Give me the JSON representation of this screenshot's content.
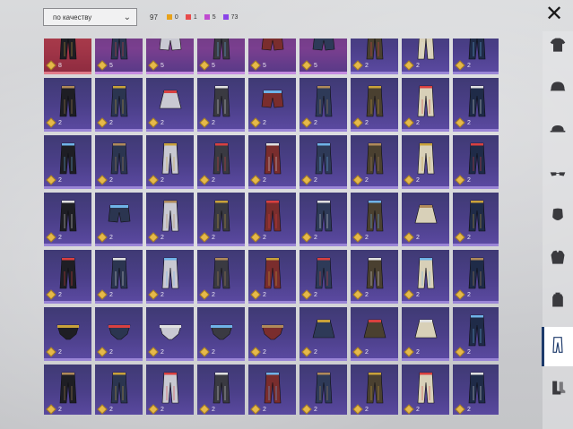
{
  "toolbar": {
    "sort_label": "по качеству",
    "total_count": "97",
    "rarity_counts": [
      {
        "color": "#e8a21a",
        "value": "0"
      },
      {
        "color": "#e84b4b",
        "value": "1"
      },
      {
        "color": "#c04ad0",
        "value": "5"
      },
      {
        "color": "#8a44e8",
        "value": "73"
      }
    ]
  },
  "close_icon": "✕",
  "grid": {
    "rows": [
      {
        "tier": "top",
        "items": [
          {
            "style": "red",
            "item": "pants-icon",
            "qty": "8"
          },
          {
            "style": "pink",
            "item": "pants-icon",
            "qty": "5"
          },
          {
            "style": "pink",
            "item": "shorts-icon",
            "qty": "5"
          },
          {
            "style": "pink",
            "item": "pants-icon",
            "qty": "5"
          },
          {
            "style": "pink",
            "item": "shorts-icon",
            "qty": "5"
          },
          {
            "style": "pink",
            "item": "shorts-icon",
            "qty": "5"
          },
          {
            "style": "purple",
            "item": "pants-icon",
            "qty": "2"
          },
          {
            "style": "purple",
            "item": "pants-icon",
            "qty": "2"
          },
          {
            "style": "purple",
            "item": "pants-icon",
            "qty": "2"
          }
        ]
      },
      {
        "tier": "1",
        "items": [
          {
            "style": "purple",
            "item": "pants-icon",
            "qty": "2"
          },
          {
            "style": "purple",
            "item": "pants-icon",
            "qty": "2"
          },
          {
            "style": "purple",
            "item": "skirt-icon",
            "qty": "2"
          },
          {
            "style": "purple",
            "item": "pants-icon",
            "qty": "2"
          },
          {
            "style": "purple",
            "item": "shorts-icon",
            "qty": "2"
          },
          {
            "style": "purple",
            "item": "pants-icon",
            "qty": "2"
          },
          {
            "style": "purple",
            "item": "pants-icon",
            "qty": "2"
          },
          {
            "style": "purple",
            "item": "pants-icon",
            "qty": "2"
          },
          {
            "style": "purple",
            "item": "pants-icon",
            "qty": "2"
          }
        ]
      },
      {
        "tier": "2",
        "items": [
          {
            "style": "purple",
            "item": "pants-icon",
            "qty": "2"
          },
          {
            "style": "purple",
            "item": "pants-icon",
            "qty": "2"
          },
          {
            "style": "purple",
            "item": "pants-icon",
            "qty": "2"
          },
          {
            "style": "purple",
            "item": "pants-icon",
            "qty": "2"
          },
          {
            "style": "purple",
            "item": "pants-icon",
            "qty": "2"
          },
          {
            "style": "purple",
            "item": "pants-icon",
            "qty": "2"
          },
          {
            "style": "purple",
            "item": "pants-icon",
            "qty": "2"
          },
          {
            "style": "purple",
            "item": "pants-icon",
            "qty": "2"
          },
          {
            "style": "purple",
            "item": "pants-icon",
            "qty": "2"
          }
        ]
      },
      {
        "tier": "3",
        "items": [
          {
            "style": "purple",
            "item": "pants-icon",
            "qty": "2"
          },
          {
            "style": "purple",
            "item": "shorts-icon",
            "qty": "2"
          },
          {
            "style": "purple",
            "item": "pants-icon",
            "qty": "2"
          },
          {
            "style": "purple",
            "item": "pants-icon",
            "qty": "2"
          },
          {
            "style": "purple",
            "item": "pants-icon",
            "qty": "2"
          },
          {
            "style": "purple",
            "item": "pants-icon",
            "qty": "2"
          },
          {
            "style": "purple",
            "item": "pants-icon",
            "qty": "2"
          },
          {
            "style": "purple",
            "item": "skirt-icon",
            "qty": "2"
          },
          {
            "style": "purple",
            "item": "pants-icon",
            "qty": "2"
          }
        ]
      },
      {
        "tier": "4",
        "items": [
          {
            "style": "purple",
            "item": "pants-icon",
            "qty": "2"
          },
          {
            "style": "purple",
            "item": "pants-icon",
            "qty": "2"
          },
          {
            "style": "purple",
            "item": "pants-icon",
            "qty": "2"
          },
          {
            "style": "purple",
            "item": "pants-icon",
            "qty": "2"
          },
          {
            "style": "purple",
            "item": "pants-icon",
            "qty": "2"
          },
          {
            "style": "purple",
            "item": "pants-icon",
            "qty": "2"
          },
          {
            "style": "purple",
            "item": "pants-icon",
            "qty": "2"
          },
          {
            "style": "purple",
            "item": "pants-icon",
            "qty": "2"
          },
          {
            "style": "purple",
            "item": "pants-icon",
            "qty": "2"
          }
        ]
      },
      {
        "tier": "5",
        "items": [
          {
            "style": "purple",
            "item": "briefs-icon",
            "qty": "2"
          },
          {
            "style": "purple",
            "item": "briefs-icon",
            "qty": "2"
          },
          {
            "style": "purple",
            "item": "briefs-icon",
            "qty": "2"
          },
          {
            "style": "purple",
            "item": "briefs-icon",
            "qty": "2"
          },
          {
            "style": "purple",
            "item": "briefs-icon",
            "qty": "2"
          },
          {
            "style": "purple",
            "item": "skirt-icon",
            "qty": "2"
          },
          {
            "style": "purple",
            "item": "skirt-icon",
            "qty": "2"
          },
          {
            "style": "purple",
            "item": "skirt-icon",
            "qty": "2"
          },
          {
            "style": "purple",
            "item": "pants-icon",
            "qty": "2"
          }
        ]
      },
      {
        "tier": "6",
        "items": [
          {
            "style": "purple",
            "item": "pants-icon",
            "qty": "2"
          },
          {
            "style": "purple",
            "item": "pants-icon",
            "qty": "2"
          },
          {
            "style": "purple",
            "item": "pants-icon",
            "qty": "2"
          },
          {
            "style": "purple",
            "item": "pants-icon",
            "qty": "2"
          },
          {
            "style": "purple",
            "item": "pants-icon",
            "qty": "2"
          },
          {
            "style": "purple",
            "item": "pants-icon",
            "qty": "2"
          },
          {
            "style": "purple",
            "item": "pants-icon",
            "qty": "2"
          },
          {
            "style": "purple",
            "item": "pants-icon",
            "qty": "2"
          },
          {
            "style": "purple",
            "item": "pants-icon",
            "qty": "2"
          }
        ]
      }
    ]
  },
  "sidebar": {
    "items": [
      {
        "icon": "shirt-icon"
      },
      {
        "icon": "helmet-icon"
      },
      {
        "icon": "cap-icon"
      },
      {
        "icon": "glasses-icon"
      },
      {
        "icon": "mask-icon"
      },
      {
        "icon": "jacket-icon"
      },
      {
        "icon": "backpack-icon"
      },
      {
        "icon": "pants-icon",
        "active": true
      },
      {
        "icon": "boots-icon"
      }
    ]
  }
}
